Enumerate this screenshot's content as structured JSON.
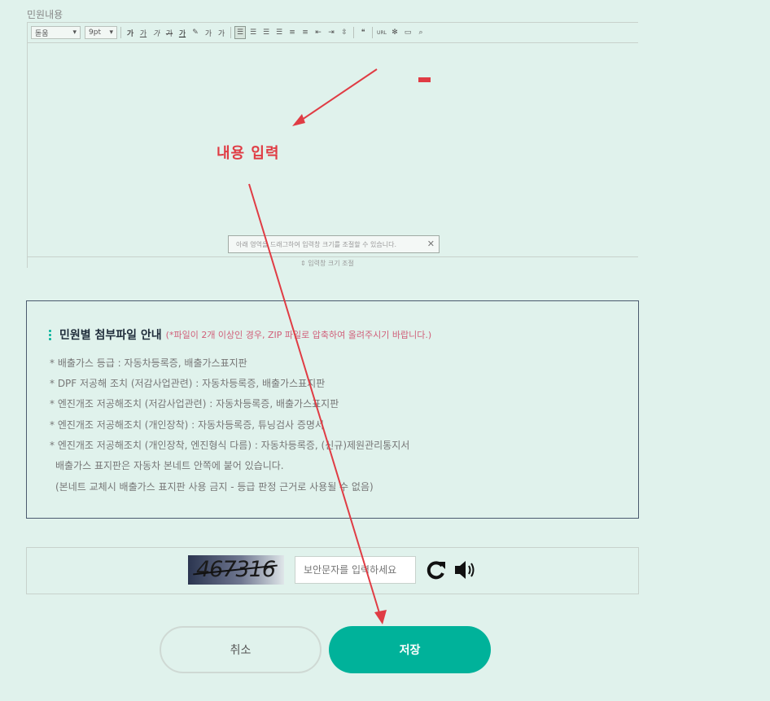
{
  "section_label": "민원내용",
  "editor": {
    "font_select": "돋움",
    "size_select": "9pt",
    "format_buttons": [
      "가",
      "가",
      "가",
      "가",
      "가",
      "가",
      "가",
      "가"
    ],
    "resize_tip": "아래 영역을 드래그하여 입력창 크기를 조절할 수 있습니다.",
    "resize_tip_close": "✕",
    "resize_handle": "⇕ 입력창 크기 조절"
  },
  "annotation": {
    "label": "내용 입력",
    "color": "#e03c44"
  },
  "guide": {
    "title": "민원별 첨부파일 안내",
    "note": "(*파일이 2개 이상인 경우, ZIP 파일로 압축하여 올려주시기 바랍니다.)",
    "lines": [
      "* 배출가스 등급 : 자동차등록증, 배출가스표지판",
      "* DPF 저공해 조치 (저감사업관련) : 자동차등록증, 배출가스표지판",
      "* 엔진개조 저공해조치 (저감사업관련) : 자동차등록증, 배출가스표지판",
      "* 엔진개조 저공해조치 (개인장착) : 자동차등록증, 튜닝검사 증명서",
      "* 엔진개조 저공해조치 (개인장착, 엔진형식 다름) : 자동차등록증, (신규)제원관리통지서",
      "배출가스 표지판은 자동차 본네트 안쪽에 붙어 있습니다.",
      "(본네트 교체시 배출가스 표지판 사용 금지 - 등급 판정 근거로 사용될 수 없음)"
    ]
  },
  "captcha": {
    "image_text": "467316",
    "input_value": "",
    "input_placeholder": "보안문자를 입력하세요",
    "refresh_icon": "refresh-icon",
    "audio_icon": "speaker-icon"
  },
  "buttons": {
    "cancel": "취소",
    "save": "저장"
  },
  "colors": {
    "background": "#e0f2ec",
    "accent": "#00b29a",
    "annotation": "#e03c44"
  }
}
